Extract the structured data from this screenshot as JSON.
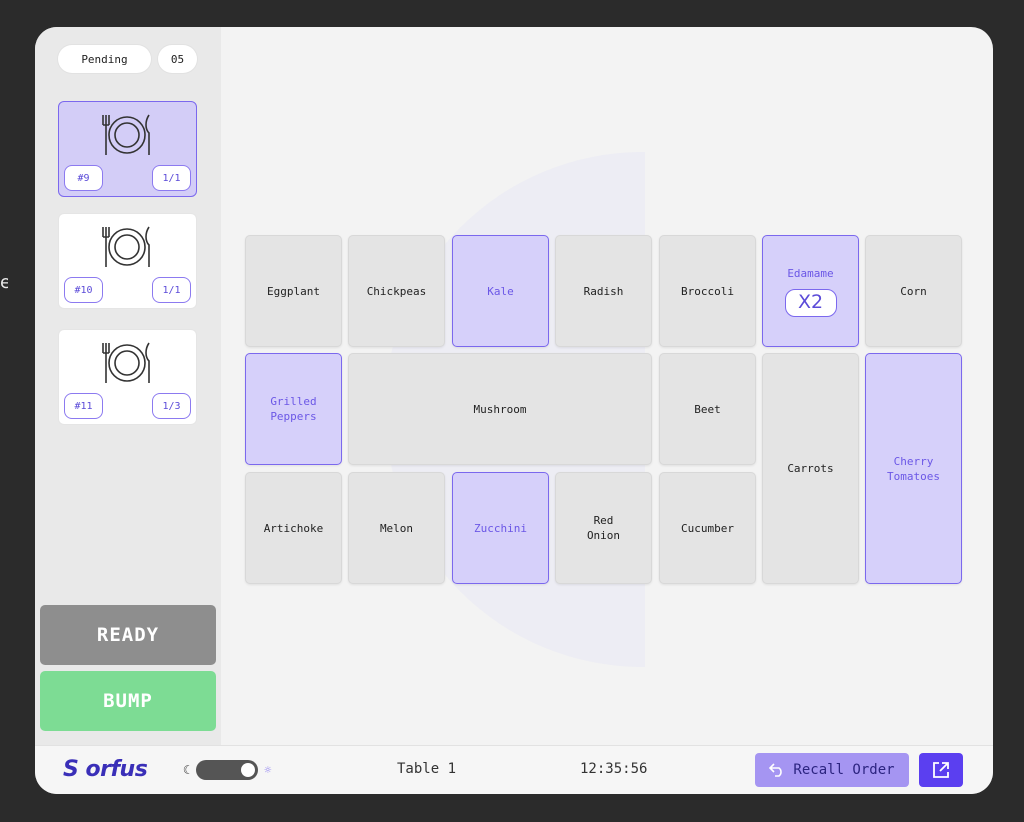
{
  "edge_text": "e",
  "queue": {
    "status": "Pending",
    "count": "05"
  },
  "orders": [
    {
      "number": "#9",
      "progress": "1/1",
      "active": true
    },
    {
      "number": "#10",
      "progress": "1/1",
      "active": false
    },
    {
      "number": "#11",
      "progress": "1/3",
      "active": false
    }
  ],
  "actions": {
    "ready": "READY",
    "bump": "BUMP"
  },
  "items": [
    {
      "label": "Eggplant",
      "selected": false
    },
    {
      "label": "Chickpeas",
      "selected": false
    },
    {
      "label": "Kale",
      "selected": true
    },
    {
      "label": "Radish",
      "selected": false
    },
    {
      "label": "Broccoli",
      "selected": false
    },
    {
      "label": "Edamame",
      "selected": true,
      "quantity": "X2"
    },
    {
      "label": "Corn",
      "selected": false
    },
    {
      "label": "Grilled Peppers",
      "selected": true
    },
    {
      "label": "Mushroom",
      "selected": false
    },
    {
      "label": "Beet",
      "selected": false
    },
    {
      "label": "Carrots",
      "selected": false
    },
    {
      "label": "Cherry Tomatoes",
      "selected": true
    },
    {
      "label": "Artichoke",
      "selected": false
    },
    {
      "label": "Melon",
      "selected": false
    },
    {
      "label": "Zucchini",
      "selected": true
    },
    {
      "label": "Red Onion",
      "selected": false
    },
    {
      "label": "Cucumber",
      "selected": false
    }
  ],
  "footer": {
    "logo": "orfus",
    "theme": {
      "dark_icon": "moon-icon",
      "light_icon": "sun-icon",
      "mode": "light"
    },
    "table": "Table 1",
    "time": "12:35:56",
    "recall_label": "Recall Order",
    "recall_icon": "undo-arrow-icon",
    "external_icon": "external-link-icon"
  },
  "colors": {
    "accent": "#7b68ee",
    "selected_fill": "#d6d0fa",
    "ready": "#8e8e8e",
    "bump": "#7ddc94",
    "recall": "#a595f2",
    "external": "#5b3ff0"
  }
}
